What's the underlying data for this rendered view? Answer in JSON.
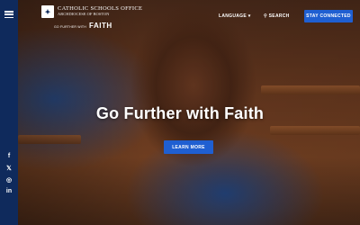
{
  "header": {
    "logo_emblem": "✦",
    "logo_title": "CATHOLIC SCHOOLS OFFICE",
    "logo_subtitle": "ARCHDIOCESE OF BOSTON",
    "tagline_small": "GO FURTHER WITH",
    "tagline_faith": "FAITH",
    "language_label": "LANGUAGE",
    "language_caret": "▾",
    "search_label": "SEARCH",
    "search_icon": "⚲",
    "cta_label": "STAY CONNECTED"
  },
  "sidebar": {
    "menu_icon": "hamburger-icon",
    "social": [
      {
        "name": "facebook-icon",
        "glyph": "f"
      },
      {
        "name": "x-icon",
        "glyph": "𝕏"
      },
      {
        "name": "instagram-icon",
        "glyph": "◎"
      },
      {
        "name": "linkedin-icon",
        "glyph": "in"
      }
    ]
  },
  "hero": {
    "title": "Go Further with Faith",
    "button_label": "LEARN MORE"
  },
  "colors": {
    "navy": "#0f2a5c",
    "accent_blue": "#1f5fd1"
  }
}
